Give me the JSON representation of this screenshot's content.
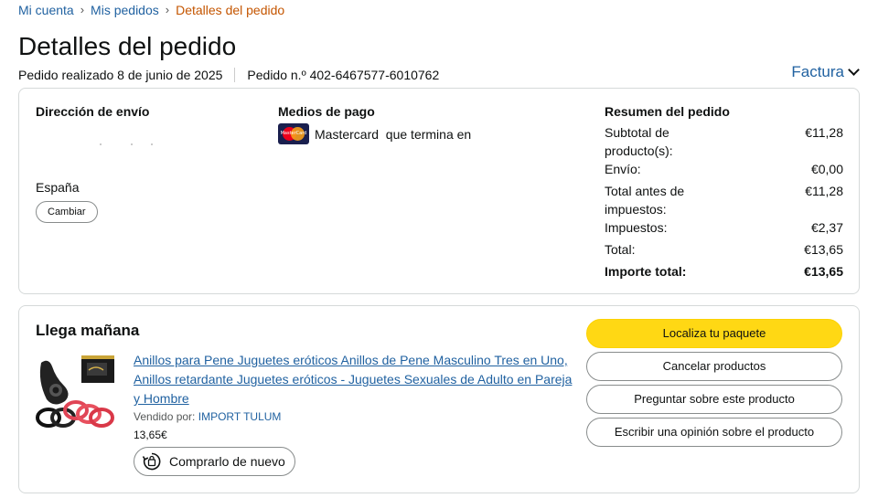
{
  "breadcrumb": {
    "items": [
      "Mi cuenta",
      "Mis pedidos"
    ],
    "current": "Detalles del pedido",
    "separator": "›"
  },
  "page_title": "Detalles del pedido",
  "order": {
    "placed": "Pedido realizado 8 de junio de 2025",
    "number": "Pedido n.º 402-6467577-6010762",
    "invoice_label": "Factura"
  },
  "shipping": {
    "title": "Dirección de envío",
    "country": "España",
    "change_label": "Cambiar"
  },
  "payment": {
    "title": "Medios de pago",
    "card_logo_text": "MasterCard",
    "method_text": "Mastercard  que termina en"
  },
  "summary": {
    "title": "Resumen del pedido",
    "rows": [
      {
        "label": "Subtotal de producto(s):",
        "value": "€11,28"
      },
      {
        "label": "Envío:",
        "value": "€0,00"
      },
      {
        "label": "Total antes de impuestos:",
        "value": "€11,28"
      },
      {
        "label": "Impuestos:",
        "value": "€2,37"
      },
      {
        "label": "Total:",
        "value": "€13,65"
      },
      {
        "label": "Importe total:",
        "value": "€13,65"
      }
    ]
  },
  "shipment": {
    "status": "Llega mañana",
    "product_title": "Anillos para Pene Juguetes eróticos Anillos de Pene Masculino Tres en Uno, Anillos retardante Juguetes eróticos - Juguetes Sexuales de Adulto en Pareja y Hombre",
    "sold_by_label": "Vendido por:",
    "seller": "IMPORT TULUM",
    "price": "13,65€",
    "buy_again_label": "Comprarlo de nuevo"
  },
  "actions": {
    "track": "Localiza tu paquete",
    "cancel": "Cancelar productos",
    "ask": "Preguntar sobre este producto",
    "review": "Escribir una opinión sobre el producto"
  },
  "colors": {
    "link": "#2162a1",
    "breadcrumb_current": "#c45500",
    "primary_button": "#ffd814",
    "border": "#d5d9d9"
  },
  "icons": [
    "chevron-down-icon",
    "mastercard-icon",
    "reorder-icon"
  ]
}
